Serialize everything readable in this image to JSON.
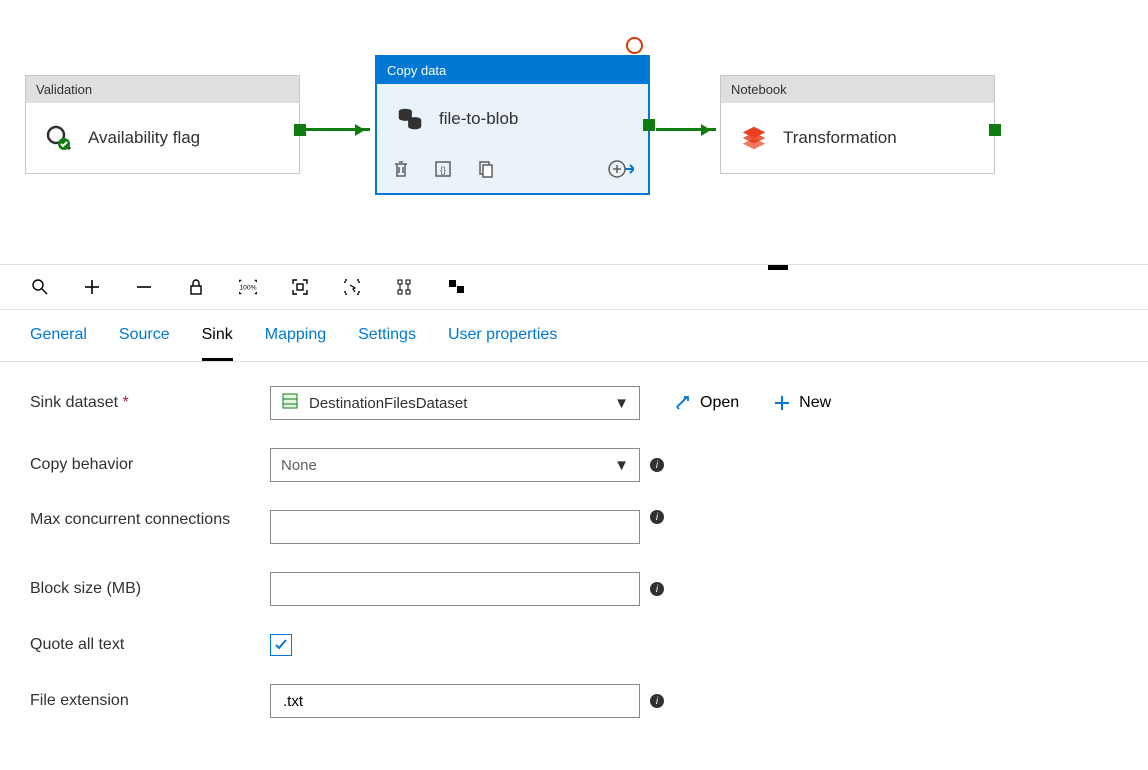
{
  "pipeline": {
    "validation": {
      "header": "Validation",
      "title": "Availability flag"
    },
    "copy": {
      "header": "Copy data",
      "title": "file-to-blob"
    },
    "notebook": {
      "header": "Notebook",
      "title": "Transformation"
    }
  },
  "tabs": {
    "general": "General",
    "source": "Source",
    "sink": "Sink",
    "mapping": "Mapping",
    "settings": "Settings",
    "user_properties": "User properties"
  },
  "actions": {
    "open": "Open",
    "new": "New"
  },
  "form": {
    "sink_dataset": {
      "label": "Sink dataset",
      "value": "DestinationFilesDataset"
    },
    "copy_behavior": {
      "label": "Copy behavior",
      "value": "None"
    },
    "max_conn": {
      "label": "Max concurrent connections",
      "value": ""
    },
    "block_size": {
      "label": "Block size (MB)",
      "value": ""
    },
    "quote_all": {
      "label": "Quote all text"
    },
    "file_ext": {
      "label": "File extension",
      "value": ".txt"
    }
  }
}
